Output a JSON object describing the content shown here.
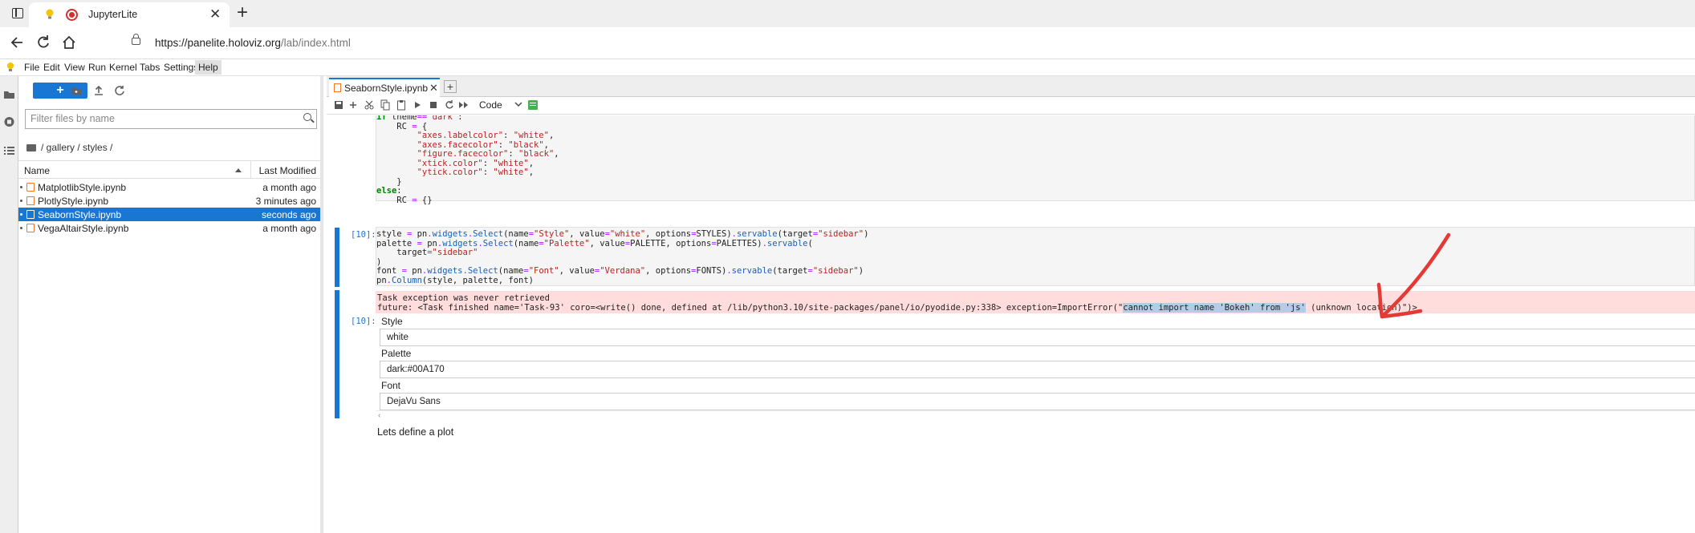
{
  "browser": {
    "tab_title": "JupyterLite",
    "tab_close": "✕",
    "new_tab": "+",
    "url_host": "https://panelite.holoviz.org",
    "url_path": "/lab/index.html"
  },
  "menu": {
    "items": [
      "File",
      "Edit",
      "View",
      "Run",
      "Kernel",
      "Tabs",
      "Settings",
      "Help"
    ],
    "active": "Help"
  },
  "filebrowser": {
    "new_label": "+",
    "filter_placeholder": "Filter files by name",
    "breadcrumb": "/ gallery / styles /",
    "col_name": "Name",
    "col_modified": "Last Modified",
    "files": [
      {
        "name": "MatplotlibStyle.ipynb",
        "modified": "a month ago",
        "selected": false
      },
      {
        "name": "PlotlyStyle.ipynb",
        "modified": "3 minutes ago",
        "selected": false
      },
      {
        "name": "SeabornStyle.ipynb",
        "modified": "seconds ago",
        "selected": true
      },
      {
        "name": "VegaAltairStyle.ipynb",
        "modified": "a month ago",
        "selected": false
      }
    ]
  },
  "notebook": {
    "tab_title": "SeabornStyle.ipynb",
    "tab_close": "✕",
    "add_tab": "+",
    "cell_type": "Code",
    "cell1_code_lines": [
      "if theme==\"dark\":",
      "    RC = {",
      "        \"axes.labelcolor\": \"white\",",
      "        \"axes.facecolor\": \"black\",",
      "        \"figure.facecolor\": \"black\",",
      "        \"xtick.color\": \"white\",",
      "        \"ytick.color\": \"white\",",
      "    }",
      "else:",
      "    RC = {}"
    ],
    "cell2_prompt": "[10]:",
    "cell2_code_lines": [
      "style = pn.widgets.Select(name=\"Style\", value=\"white\", options=STYLES).servable(target=\"sidebar\")",
      "palette = pn.widgets.Select(name=\"Palette\", value=PALETTE, options=PALETTES).servable(",
      "    target=\"sidebar\"",
      ")",
      "font = pn.widgets.Select(name=\"Font\", value=\"Verdana\", options=FONTS).servable(target=\"sidebar\")",
      "pn.Column(style, palette, font)"
    ],
    "error_line1": "Task exception was never retrieved",
    "error_line2_pre": "future: <Task finished name='Task-93' coro=<write() done, defined at /lib/python3.10/site-packages/panel/io/pyodide.py:338> exception=ImportError(\"",
    "error_line2_hl": "cannot import name 'Bokeh' from 'js'",
    "error_line2_post": " (unknown location)\")>",
    "output_prompt": "[10]:",
    "widgets": [
      {
        "label": "Style",
        "value": "white"
      },
      {
        "label": "Palette",
        "value": "dark:#00A170"
      },
      {
        "label": "Font",
        "value": "DejaVu Sans"
      }
    ],
    "scroll_arrow": "‹",
    "markdown": "Lets define a plot"
  },
  "colors": {
    "accent": "#1976d2",
    "error_bg": "#ffdddd",
    "annotation_arrow": "#e53935"
  }
}
